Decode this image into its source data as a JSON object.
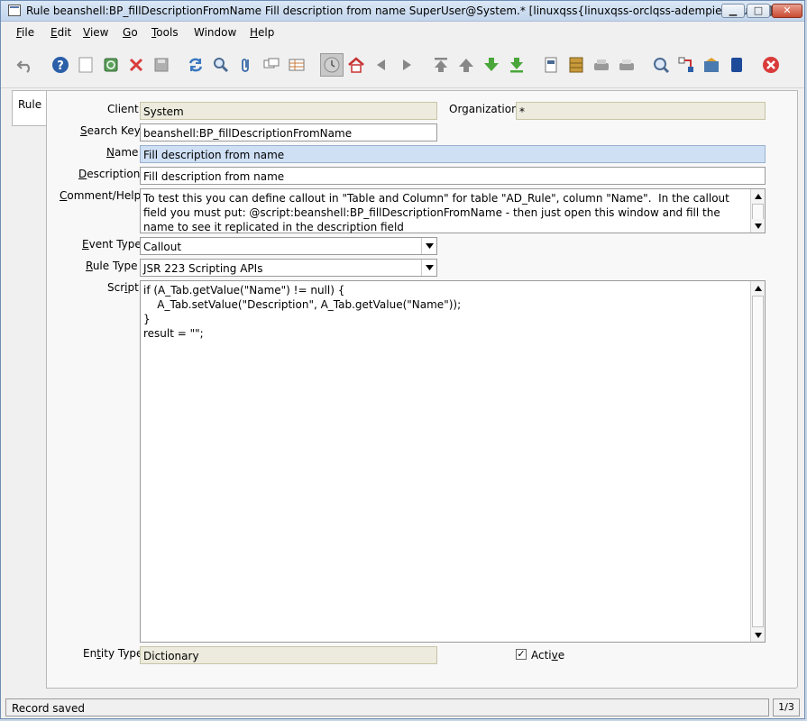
{
  "window": {
    "title": "Rule  beanshell:BP_fillDescriptionFromName  Fill description from name  SuperUser@System.* [linuxqss{linuxqss-orclqss-adempieretrunk}]",
    "min_glyph": "▁",
    "max_glyph": "□",
    "close_glyph": "✕"
  },
  "menu": [
    {
      "u": "F",
      "rest": "ile"
    },
    {
      "u": "E",
      "rest": "dit"
    },
    {
      "u": "V",
      "rest": "iew"
    },
    {
      "u": "G",
      "rest": "o"
    },
    {
      "u": "T",
      "rest": "ools"
    },
    {
      "pre": "Window"
    },
    {
      "u": "H",
      "rest": "elp"
    }
  ],
  "tab": {
    "label": "Rule"
  },
  "form": {
    "client_label": "Client",
    "client_value": "System",
    "org_label": "Organization",
    "org_value": "*",
    "searchkey_label_u": "S",
    "searchkey_label_rest": "earch Key",
    "searchkey_value": "beanshell:BP_fillDescriptionFromName",
    "name_label_u": "N",
    "name_label_rest": "ame",
    "name_value": "Fill description from name",
    "desc_label_u": "D",
    "desc_label_rest": "escription",
    "desc_value": "Fill description from name",
    "comment_label_u": "C",
    "comment_label_rest": "omment/Help",
    "comment_value": "To test this you can define callout in \"Table and Column\" for table \"AD_Rule\", column \"Name\".  In the callout field you must put: @script:beanshell:BP_fillDescriptionFromName - then just open this window and fill the name to see it replicated in the description field",
    "eventtype_label_u": "E",
    "eventtype_label_rest": "vent Type",
    "eventtype_value": "Callout",
    "ruletype_label_u": "R",
    "ruletype_label_rest": "ule Type",
    "ruletype_value": "JSR 223 Scripting APIs",
    "script_label_pre": "Scr",
    "script_label_u": "i",
    "script_label_rest": "pt",
    "script_value": "if (A_Tab.getValue(\"Name\") != null) {\n    A_Tab.setValue(\"Description\", A_Tab.getValue(\"Name\"));\n}\nresult = \"\";",
    "entitytype_label_pre": "En",
    "entitytype_label_u": "t",
    "entitytype_label_rest": "ity Type",
    "entitytype_value": "Dictionary",
    "active_label_pre": "Acti",
    "active_label_u": "v",
    "active_label_rest": "e",
    "active_checked": true
  },
  "status": {
    "message": "Record saved",
    "record": "1/3"
  }
}
